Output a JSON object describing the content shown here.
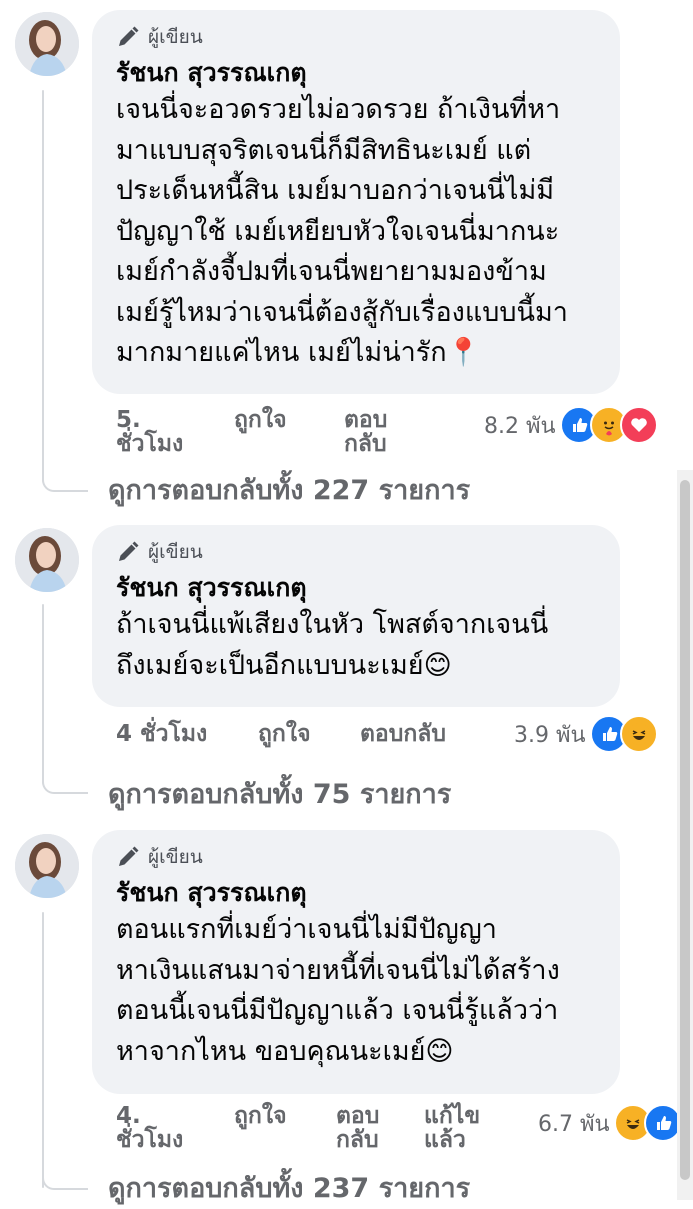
{
  "comments": [
    {
      "badge": "ผู้เขียน",
      "author": "รัชนก สุวรรณเกตุ",
      "text": "เจนนี่จะอวดรวยไม่อวดรวย ถ้าเงินที่หา\nมาแบบสุจริตเจนนี่ก็มีสิทธินะเมย์ แต่\nประเด็นหนี้สิน เมย์มาบอกว่าเจนนี่ไม่มี\nปัญญาใช้ เมย์เหยียบหัวใจเจนนี่มากนะ\nเมย์กำลังจี้ปมที่เจนนี่พยายามมองข้าม\nเมย์รู้ไหมว่าเจนนี่ต้องสู้กับเรื่องแบบนี้มา\nมากมายแค่ไหน เมย์ไม่น่ารัก📍",
      "time_line1": "5.",
      "time_line2": "ชั่วโมง",
      "like": "ถูกใจ",
      "reply_line1": "ตอบ",
      "reply_line2": "กลับ",
      "reaction_count": "8.2 พัน",
      "reaction_icons": [
        "like-icon",
        "care-icon",
        "love-icon"
      ],
      "view_replies": "ดูการตอบกลับทั้ง 227 รายการ"
    },
    {
      "badge": "ผู้เขียน",
      "author": "รัชนก สุวรรณเกตุ",
      "text": "ถ้าเจนนี่แพ้เสียงในหัว โพสต์จากเจนนี่\nถึงเมย์จะเป็นอีกแบบนะเมย์😊",
      "time": "4 ชั่วโมง",
      "like": "ถูกใจ",
      "reply": "ตอบกลับ",
      "reaction_count": "3.9 พัน",
      "reaction_icons": [
        "like-icon",
        "haha-icon"
      ],
      "view_replies": "ดูการตอบกลับทั้ง 75 รายการ"
    },
    {
      "badge": "ผู้เขียน",
      "author": "รัชนก สุวรรณเกตุ",
      "text": "ตอนแรกที่เมย์ว่าเจนนี่ไม่มีปัญญา\nหาเงินแสนมาจ่ายหนี้ที่เจนนี่ไม่ได้สร้าง\nตอนนี้เจนนี่มีปัญญาแล้ว เจนนี่รู้แล้วว่า\nหาจากไหน ขอบคุณนะเมย์😊",
      "time_line1": "4.",
      "time_line2": "ชั่วโมง",
      "like": "ถูกใจ",
      "reply_line1": "ตอบ",
      "reply_line2": "กลับ",
      "edited_line1": "แก้ไข",
      "edited_line2": "แล้ว",
      "reaction_count": "6.7 พัน",
      "reaction_icons": [
        "haha-icon",
        "like-icon"
      ],
      "view_replies": "ดูการตอบกลับทั้ง 237 รายการ"
    }
  ],
  "colors": {
    "bubble": "#f0f2f5",
    "secondary_text": "#65676b",
    "like_blue": "#1877f2",
    "love_red": "#f33e58",
    "haha_yellow": "#f7b125"
  }
}
